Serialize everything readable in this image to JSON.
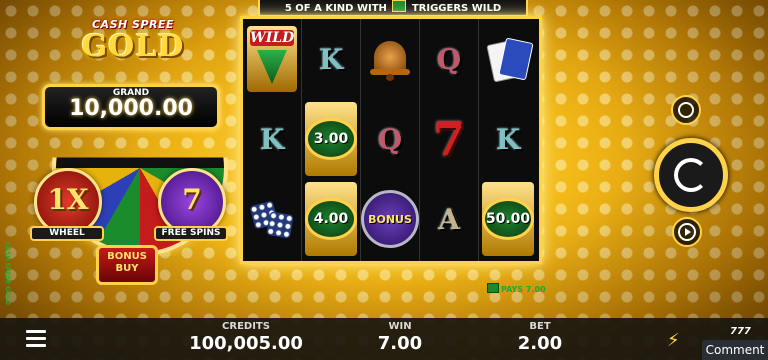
{
  "logo": {
    "top": "CASH SPREE",
    "main": "GOLD",
    "side": "CASH SPREE GOLD"
  },
  "jackpot": {
    "label": "GRAND",
    "amount": "10,000.00"
  },
  "features": {
    "wheel": {
      "value": "1X",
      "label": "WHEEL"
    },
    "free_spins": {
      "value": "7",
      "label": "FREE SPINS"
    },
    "bonus_buy": {
      "line1": "BONUS",
      "line2": "BUY"
    }
  },
  "banner": {
    "before": "5 OF A KIND WITH",
    "after": "TRIGGERS WILD JACKPOT!"
  },
  "reels": [
    [
      "WILD",
      "K",
      "dice"
    ],
    [
      "K",
      "3.00",
      "4.00"
    ],
    [
      "bell",
      "Q",
      "BONUS"
    ],
    [
      "Q",
      "7",
      "A"
    ],
    [
      "cards",
      "K",
      "50.00"
    ]
  ],
  "symbols": {
    "wild": "WILD",
    "k": "K",
    "q": "Q",
    "a": "A",
    "seven": "7",
    "bonus": "BONUS",
    "cash1": "3.00",
    "cash2": "4.00",
    "cash3": "50.00"
  },
  "pays": "PAYS 7.00",
  "bottom": {
    "credits_label": "CREDITS",
    "credits_value": "100,005.00",
    "win_label": "WIN",
    "win_value": "7.00",
    "bet_label": "BET",
    "bet_value": "2.00",
    "sevens": "777",
    "comment": "Comment"
  },
  "icons": [
    "menu-icon",
    "coins-icon",
    "spin-icon",
    "autoplay-icon",
    "lightning-icon"
  ],
  "colors": {
    "accent": "#ffd24a",
    "bar": "#19160f",
    "win_green": "#1ea83a"
  }
}
